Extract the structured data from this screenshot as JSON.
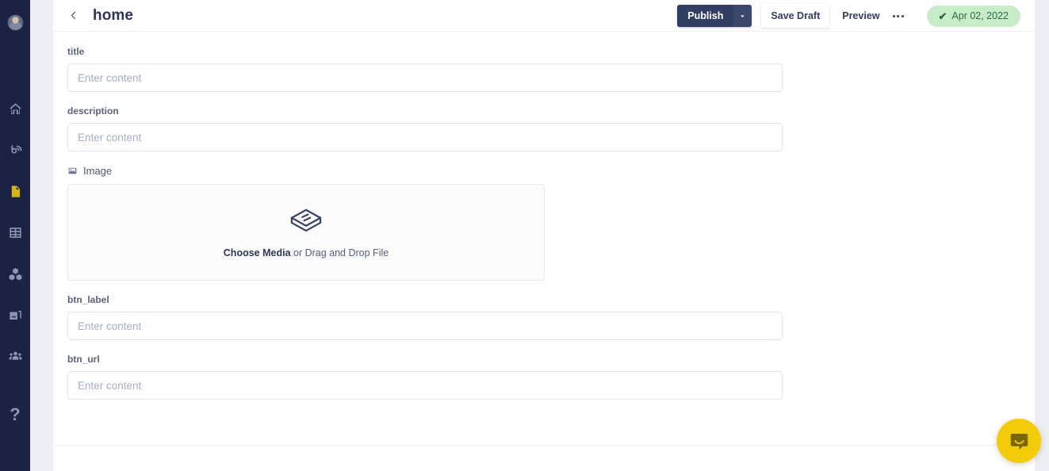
{
  "sidebar": {
    "avatar_name": "user-avatar",
    "items": [
      {
        "icon": "home-icon",
        "name": "sidebar-item-home"
      },
      {
        "icon": "broadcast-icon",
        "name": "sidebar-item-broadcast"
      },
      {
        "icon": "page-icon",
        "name": "sidebar-item-pages",
        "active": true
      },
      {
        "icon": "table-icon",
        "name": "sidebar-item-collections"
      },
      {
        "icon": "blocks-icon",
        "name": "sidebar-item-components"
      },
      {
        "icon": "media-icon",
        "name": "sidebar-item-media"
      },
      {
        "icon": "users-icon",
        "name": "sidebar-item-users"
      }
    ],
    "help": {
      "icon": "question-mark-icon",
      "label": "?"
    }
  },
  "header": {
    "back_icon": "chevron-left-icon",
    "title": "home",
    "publish_label": "Publish",
    "publish_caret_icon": "chevron-down-icon",
    "save_draft_label": "Save Draft",
    "preview_label": "Preview",
    "more_icon": "ellipsis-icon",
    "status": {
      "check_icon": "check-icon",
      "check_glyph": "✔",
      "date": "Apr 02, 2022"
    }
  },
  "form": {
    "fields": [
      {
        "label": "title",
        "placeholder": "Enter content",
        "value": ""
      },
      {
        "label": "description",
        "placeholder": "Enter content",
        "value": ""
      }
    ],
    "media": {
      "icon": "image-icon",
      "label": "Image",
      "dropzone_icon": "layers-icon",
      "cta_bold": "Choose Media",
      "cta_rest": " or Drag and Drop File"
    },
    "fields_bottom": [
      {
        "label": "btn_label",
        "placeholder": "Enter content",
        "value": ""
      },
      {
        "label": "btn_url",
        "placeholder": "Enter content",
        "value": ""
      }
    ]
  },
  "intercom": {
    "icon": "chat-bubble-icon",
    "name": "intercom-launcher"
  },
  "colors": {
    "sidebar_bg": "#1b2242",
    "accent_active": "#d8b513",
    "publish_bg": "#333e63",
    "badge_bg": "#c8ecca",
    "badge_text": "#2f6b41",
    "intercom_bg": "#f2cb0a"
  }
}
